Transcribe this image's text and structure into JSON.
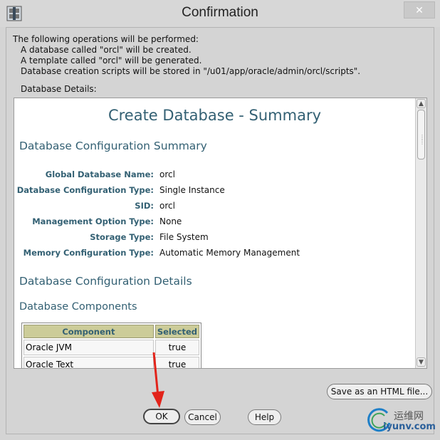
{
  "window": {
    "title": "Confirmation",
    "close_label": "✕"
  },
  "intro": {
    "heading": "The following operations will be performed:",
    "lines": [
      "A database called \"orcl\" will be created.",
      "A template called \"orcl\" will be generated.",
      "Database creation scripts will be stored in \"/u01/app/oracle/admin/orcl/scripts\"."
    ],
    "details_label": "Database Details:"
  },
  "summary": {
    "title": "Create Database - Summary",
    "config_summary_heading": "Database Configuration Summary",
    "fields": [
      {
        "label": "Global Database Name:",
        "value": "orcl"
      },
      {
        "label": "Database Configuration Type:",
        "value": "Single Instance"
      },
      {
        "label": "SID:",
        "value": "orcl"
      },
      {
        "label": "Management Option Type:",
        "value": "None"
      },
      {
        "label": "Storage Type:",
        "value": "File System"
      },
      {
        "label": "Memory Configuration Type:",
        "value": "Automatic Memory Management"
      }
    ],
    "config_details_heading": "Database Configuration Details",
    "components_heading": "Database Components",
    "components_table": {
      "headers": [
        "Component",
        "Selected"
      ],
      "rows": [
        [
          "Oracle JVM",
          "true"
        ],
        [
          "Oracle Text",
          "true"
        ]
      ]
    }
  },
  "buttons": {
    "save_html": "Save as an HTML file...",
    "ok": "OK",
    "cancel": "Cancel",
    "help": "Help"
  },
  "watermark": {
    "cn_text": "运维网",
    "url": "iyunv.com"
  },
  "colors": {
    "heading_teal": "#336073",
    "table_header_bg": "#cccc99",
    "annotation_red": "#e2231a"
  }
}
